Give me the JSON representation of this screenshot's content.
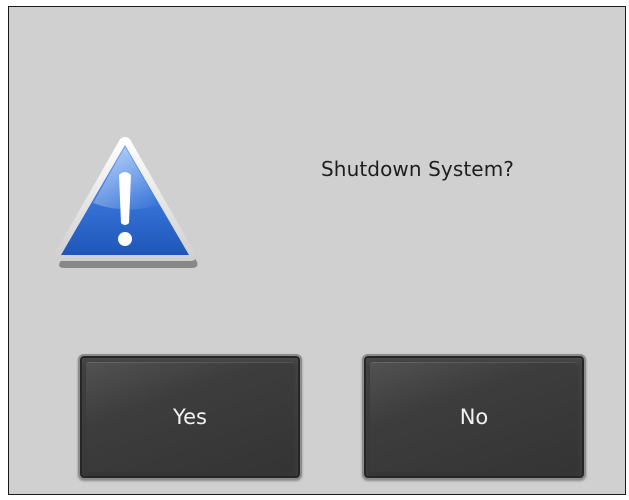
{
  "dialog": {
    "message": "Shutdown System?",
    "icon": "warning-icon",
    "buttons": {
      "yes_label": "Yes",
      "no_label": "No"
    }
  },
  "colors": {
    "background": "#d0d0d0",
    "icon_blue": "#2f6fd6",
    "button_fill": "#3a3a3a",
    "button_text": "#f2f2f2"
  }
}
